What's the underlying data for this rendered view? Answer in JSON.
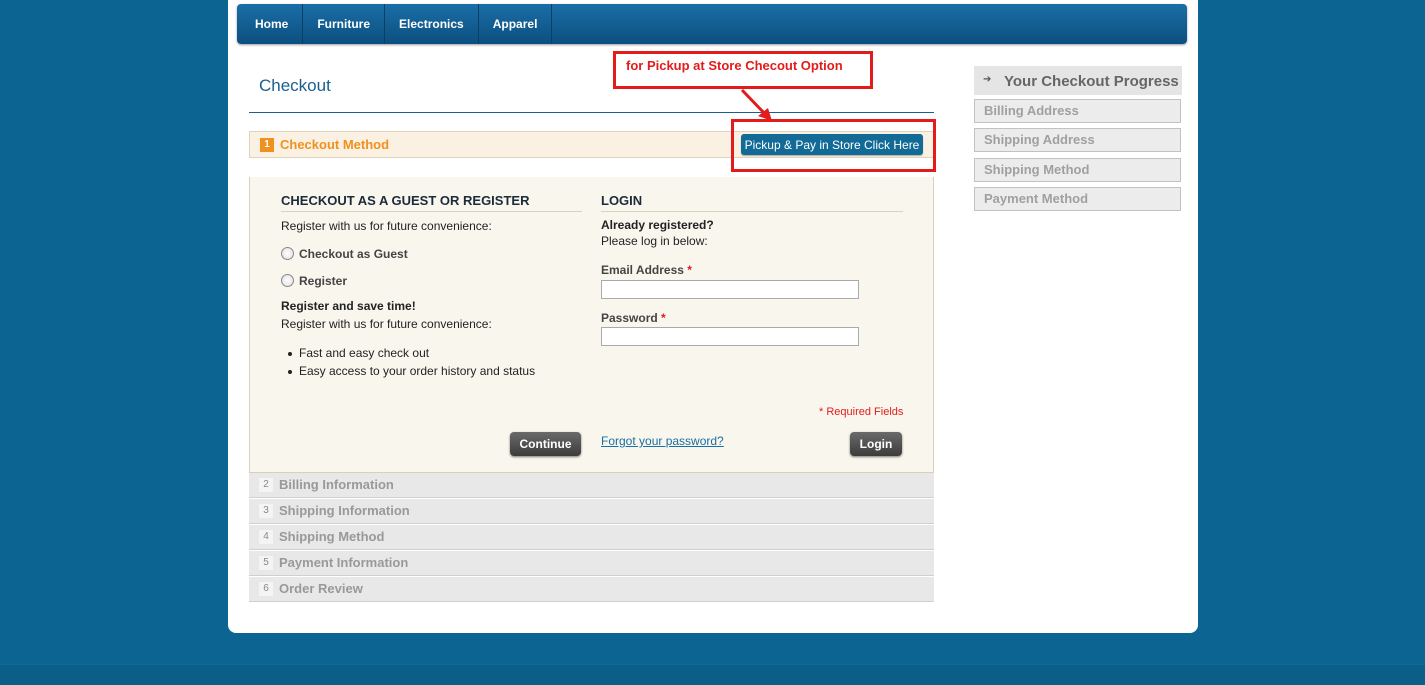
{
  "nav": {
    "items": [
      "Home",
      "Furniture",
      "Electronics",
      "Apparel"
    ]
  },
  "page_title": "Checkout",
  "annotation": {
    "text": "for Pickup at Store Checout Option"
  },
  "active_step": {
    "number": "1",
    "title": "Checkout Method",
    "pickup_button": "Pickup & Pay in Store Click Here"
  },
  "guest": {
    "heading": "CHECKOUT AS A GUEST OR REGISTER",
    "intro": "Register with us for future convenience:",
    "option_guest": "Checkout as Guest",
    "option_register": "Register",
    "save_title": "Register and save time!",
    "save_sub": "Register with us for future convenience:",
    "bullets": [
      "Fast and easy check out",
      "Easy access to your order history and status"
    ],
    "continue_button": "Continue"
  },
  "login": {
    "heading": "LOGIN",
    "already": "Already registered?",
    "please": "Please log in below:",
    "email_label": "Email Address",
    "password_label": "Password",
    "required_star": "*",
    "required_note": "* Required Fields",
    "forgot_link": "Forgot your password?",
    "login_button": "Login",
    "email_value": "",
    "password_value": ""
  },
  "steps": [
    {
      "number": "2",
      "title": "Billing Information"
    },
    {
      "number": "3",
      "title": "Shipping Information"
    },
    {
      "number": "4",
      "title": "Shipping Method"
    },
    {
      "number": "5",
      "title": "Payment Information"
    },
    {
      "number": "6",
      "title": "Order Review"
    }
  ],
  "progress": {
    "title": "Your Checkout Progress",
    "icon": "arrow-right-icon",
    "items": [
      "Billing Address",
      "Shipping Address",
      "Shipping Method",
      "Payment Method"
    ]
  },
  "colors": {
    "background": "#0b6491",
    "accent_orange": "#f0901e",
    "annotation_red": "#e31b1b",
    "link_blue": "#1a6ea6"
  }
}
